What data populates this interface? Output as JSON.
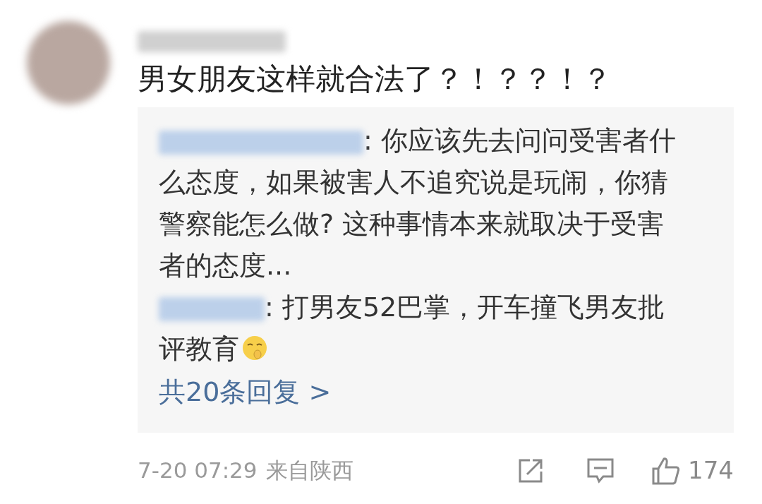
{
  "comment": {
    "text": "男女朋友这样就合法了？！？？！？",
    "replies": [
      {
        "kind": "plain",
        "text": ": 你应该先去问问受害者什么态度，如果被害人不追究说是玩闹，你猜警察能怎么做? 这种事情本来就取决于受害者的态度..."
      },
      {
        "kind": "emoji_end",
        "text": ": 打男友52巴掌，开车撞飞男友批评教育"
      }
    ],
    "more_replies": "共20条回复 >",
    "time": "7-20 07:29",
    "location": "来自陕西",
    "like_count": "174"
  }
}
